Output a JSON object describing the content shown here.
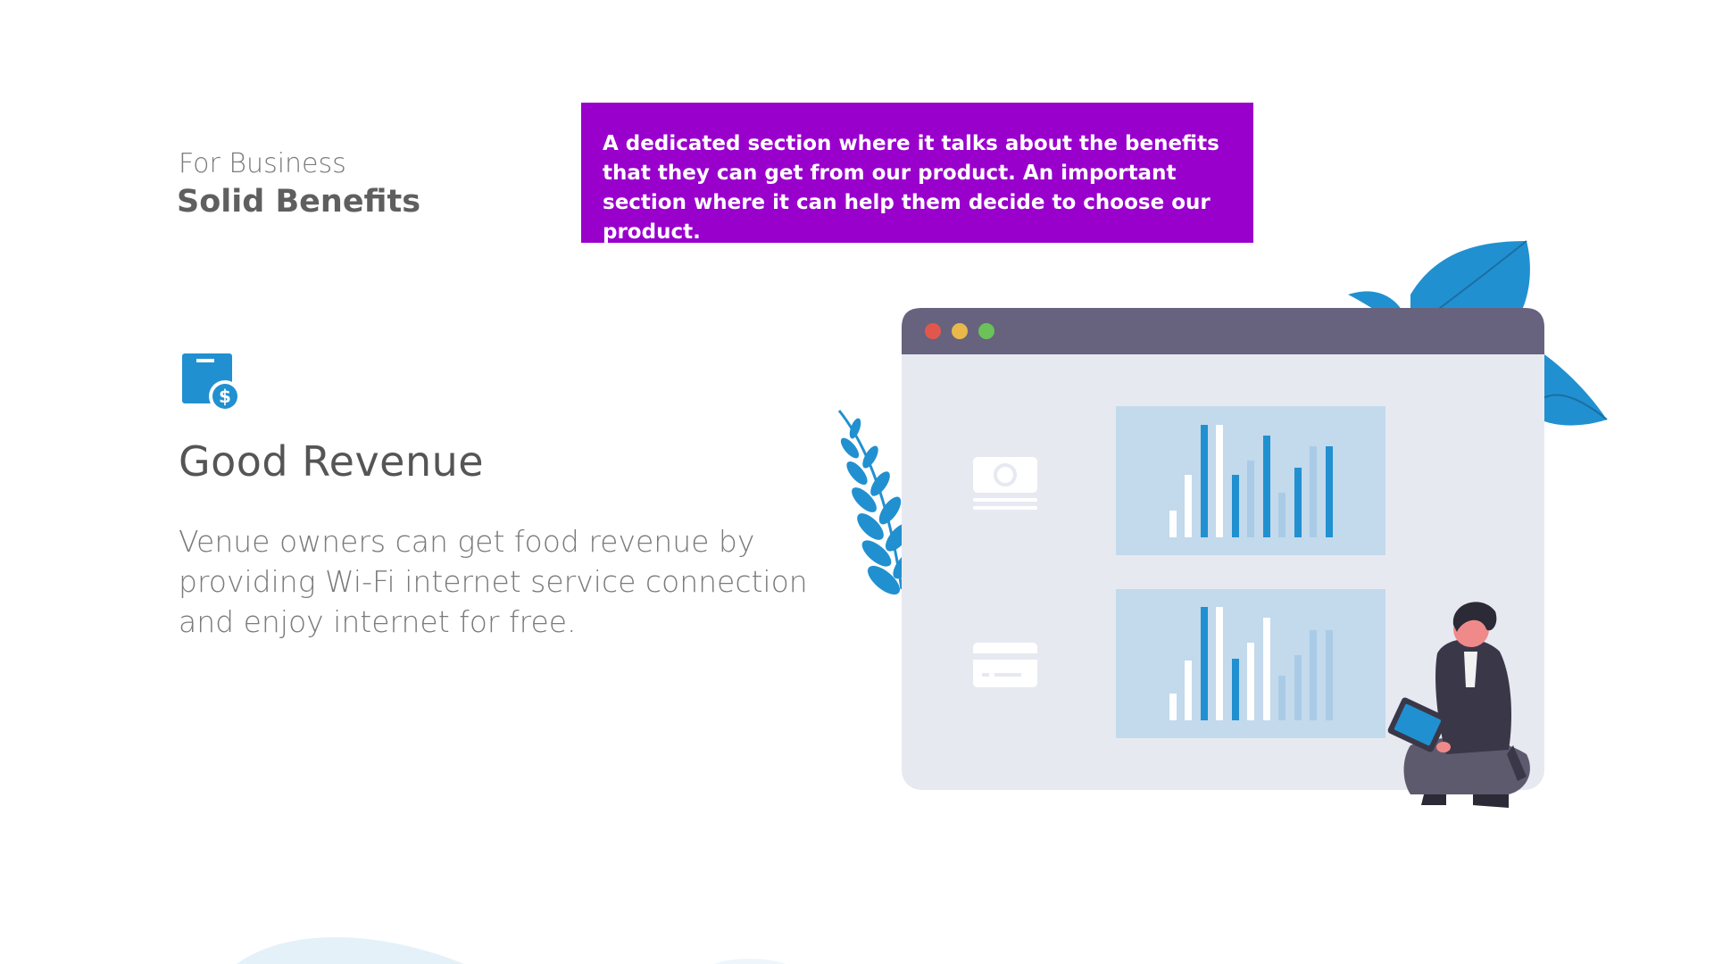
{
  "section": {
    "eyebrow": "For Business",
    "title": "Solid Benefits"
  },
  "callout": {
    "text": "A dedicated section where it talks about the benefits that they can get from our product. An important section where it can help them decide to choose our product."
  },
  "feature": {
    "icon": "revenue-box-dollar-icon",
    "title": "Good Revenue",
    "description": "Venue owners can get food revenue by providing Wi-Fi internet service connection and enjoy internet for free."
  },
  "colors": {
    "callout_bg": "#9900cc",
    "accent_blue": "#2190d0",
    "window_bar": "#67627e",
    "window_body": "#e7e9f1",
    "chart_panel": "#c3d9ec"
  }
}
